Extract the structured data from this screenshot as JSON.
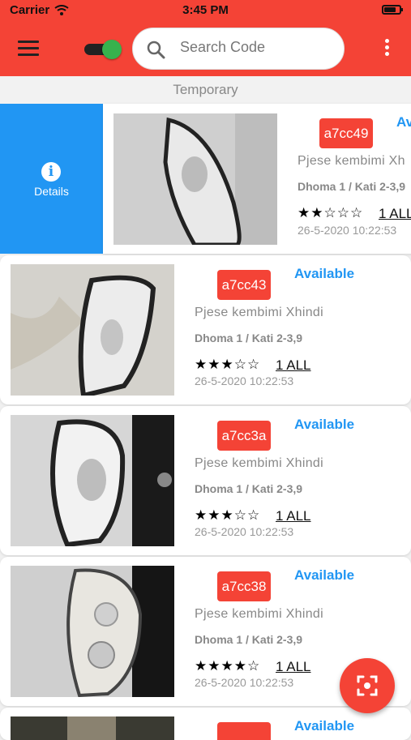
{
  "status": {
    "carrier": "Carrier",
    "time": "3:45 PM"
  },
  "appbar": {
    "search_placeholder": "Search Code"
  },
  "subheader": "Temporary",
  "swipe_action": {
    "label": "Details"
  },
  "items": [
    {
      "code": "a7cc49",
      "status": "Av",
      "name": "Pjese kembimi Xh",
      "location": "Dhoma 1 / Kati 2-3,9",
      "stars": "★★☆☆☆",
      "rating": 2,
      "price": "1 ALL",
      "date": "26-5-2020  10:22:53"
    },
    {
      "code": "a7cc43",
      "status": "Available",
      "name": "Pjese kembimi Xhindi",
      "location": "Dhoma 1 / Kati 2-3,9",
      "stars": "★★★☆☆",
      "rating": 3,
      "price": "1 ALL",
      "date": "26-5-2020  10:22:53"
    },
    {
      "code": "a7cc3a",
      "status": "Available",
      "name": "Pjese kembimi Xhindi",
      "location": "Dhoma 1 / Kati 2-3,9",
      "stars": "★★★☆☆",
      "rating": 3,
      "price": "1 ALL",
      "date": "26-5-2020  10:22:53"
    },
    {
      "code": "a7cc38",
      "status": "Available",
      "name": "Pjese kembimi Xhindi",
      "location": "Dhoma 1 / Kati 2-3,9",
      "stars": "★★★★☆",
      "rating": 4,
      "price": "1 ALL",
      "date": "26-5-2020  10:22:53"
    },
    {
      "code": "",
      "status": "Available"
    }
  ],
  "colors": {
    "accent": "#f44336",
    "link": "#2196f3",
    "star": "#f4b400"
  },
  "icons": {
    "menu": "menu-icon",
    "search": "search-icon",
    "more": "more-vert-icon",
    "info": "info-icon",
    "scan": "scan-icon",
    "wifi": "wifi-icon",
    "battery": "battery-icon"
  }
}
